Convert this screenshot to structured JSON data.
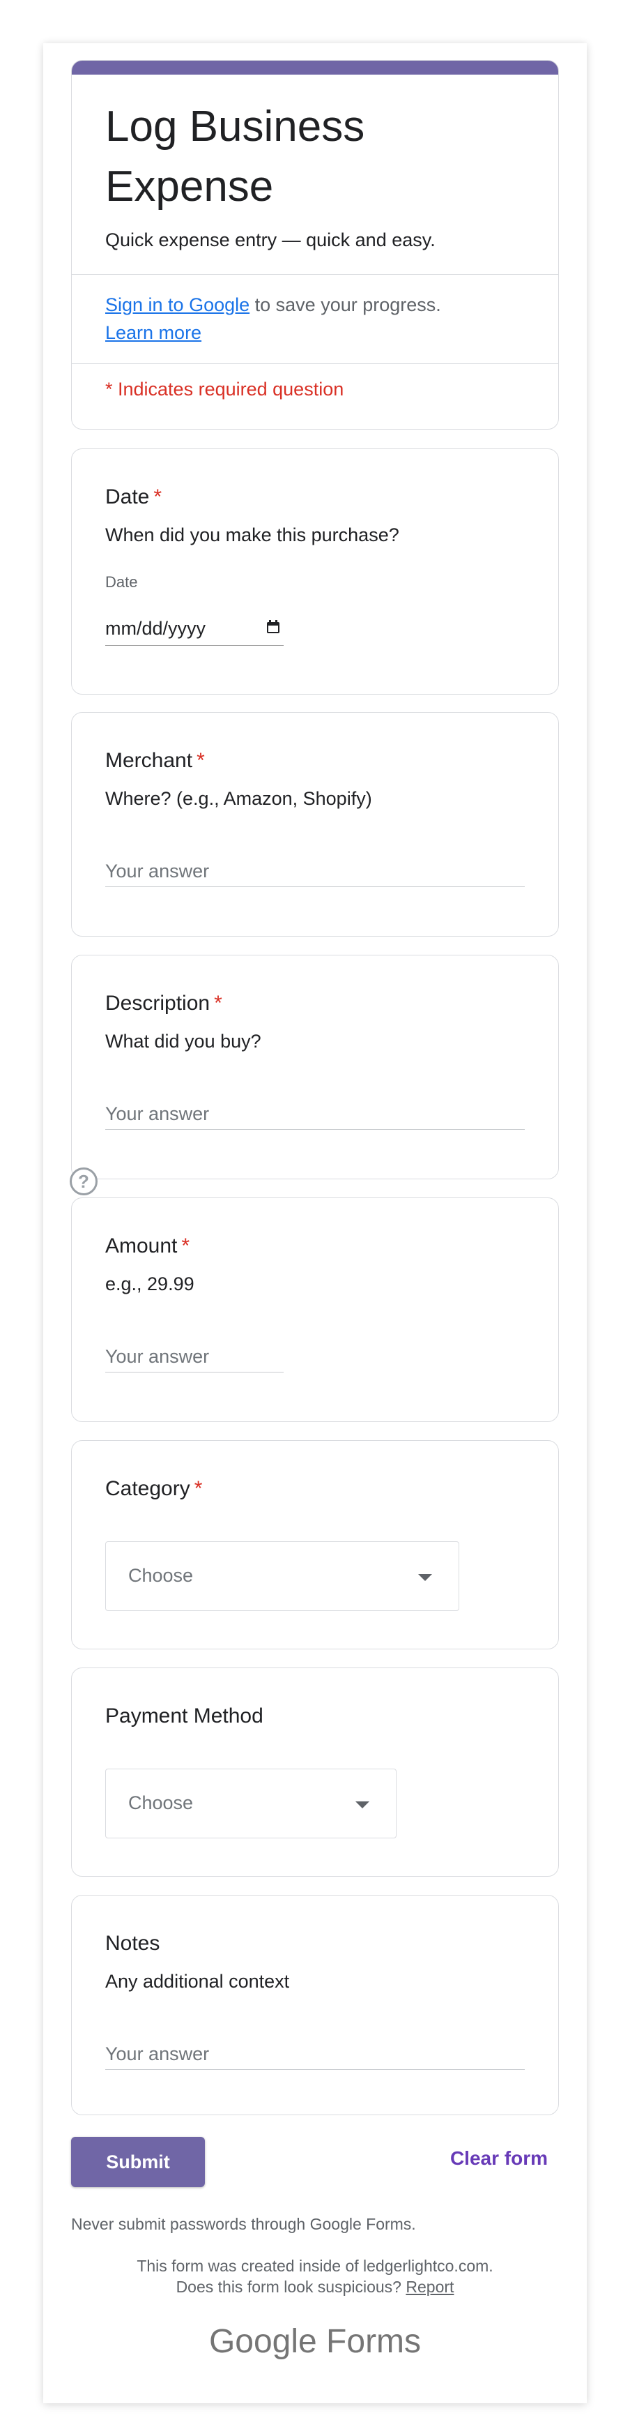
{
  "form": {
    "title": "Log Business Expense",
    "description": "Quick expense entry — quick and easy.",
    "signin_link": "Sign in to Google",
    "signin_rest": " to save your progress.",
    "learn_more": "Learn more",
    "required_note": "* Indicates required question",
    "accent_color": "#7066a6"
  },
  "questions": {
    "date": {
      "title": "Date",
      "required": "*",
      "description": "When did you make this purchase?",
      "small_label": "Date",
      "value": "mm/dd/yyyy"
    },
    "merchant": {
      "title": "Merchant",
      "required": "*",
      "description": "Where? (e.g., Amazon, Shopify)",
      "placeholder": "Your answer"
    },
    "description": {
      "title": "Description",
      "required": "*",
      "description": "What did you buy?",
      "placeholder": "Your answer"
    },
    "amount": {
      "title": "Amount",
      "required": "*",
      "description": "e.g., 29.99",
      "placeholder": "Your answer"
    },
    "category": {
      "title": "Category",
      "required": "*",
      "selected": "Choose"
    },
    "payment": {
      "title": "Payment Method",
      "selected": "Choose"
    },
    "notes": {
      "title": "Notes",
      "description": "Any additional context",
      "placeholder": "Your answer"
    }
  },
  "help_icon": "?",
  "actions": {
    "submit": "Submit",
    "clear": "Clear form"
  },
  "footer": {
    "warning": "Never submit passwords through Google Forms.",
    "created_inside": "This form was created inside of ledgerlightco.com.",
    "suspicious": "Does this form look suspicious? ",
    "report": "Report",
    "brand_google": "Google",
    "brand_forms": " Forms"
  }
}
